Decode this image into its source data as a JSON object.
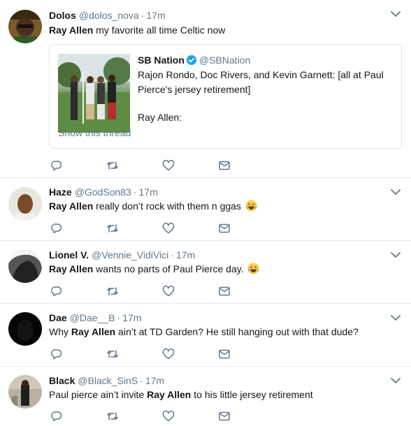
{
  "tweets": [
    {
      "name": "Dolos",
      "handle": "@dolos_nova",
      "time": "17m",
      "mention": "Ray Allen",
      "text_after": " my favorite all time Celtic now",
      "quote": {
        "name": "SB Nation",
        "handle": "@SBNation",
        "text": "Rajon Rondo, Doc Rivers, and Kevin Garnett: [all at Paul Pierce's jersey retirement]",
        "text2": "Ray Allen:",
        "show_thread": "Show this thread"
      }
    },
    {
      "name": "Haze",
      "handle": "@GodSon83",
      "time": "17m",
      "mention": "Ray Allen",
      "text_after": " really don’t rock with them n ggas"
    },
    {
      "name": "Lionel V.",
      "handle": "@Vennie_VidiVici",
      "time": "17m",
      "mention": "Ray Allen",
      "text_after": " wants no parts of Paul Pierce day."
    },
    {
      "name": "Dae",
      "handle": "@Dae__B",
      "time": "17m",
      "text_before": "Why ",
      "mention": "Ray Allen",
      "text_after": " ain’t at TD Garden? He still hanging out with that dude?"
    },
    {
      "name": "Black",
      "handle": "@Black_SinS",
      "time": "17m",
      "text_before": "Paul pierce ain’t invite ",
      "mention": "Ray Allen",
      "text_after": " to his little jersey retirement"
    }
  ],
  "separator": "·",
  "colors": {
    "icon_gray": "#657786",
    "verified_blue": "#1da1f2",
    "border": "#e6ecf0"
  },
  "icons": [
    "reply-icon",
    "retweet-icon",
    "like-icon",
    "dm-icon",
    "chevron-down-icon"
  ]
}
